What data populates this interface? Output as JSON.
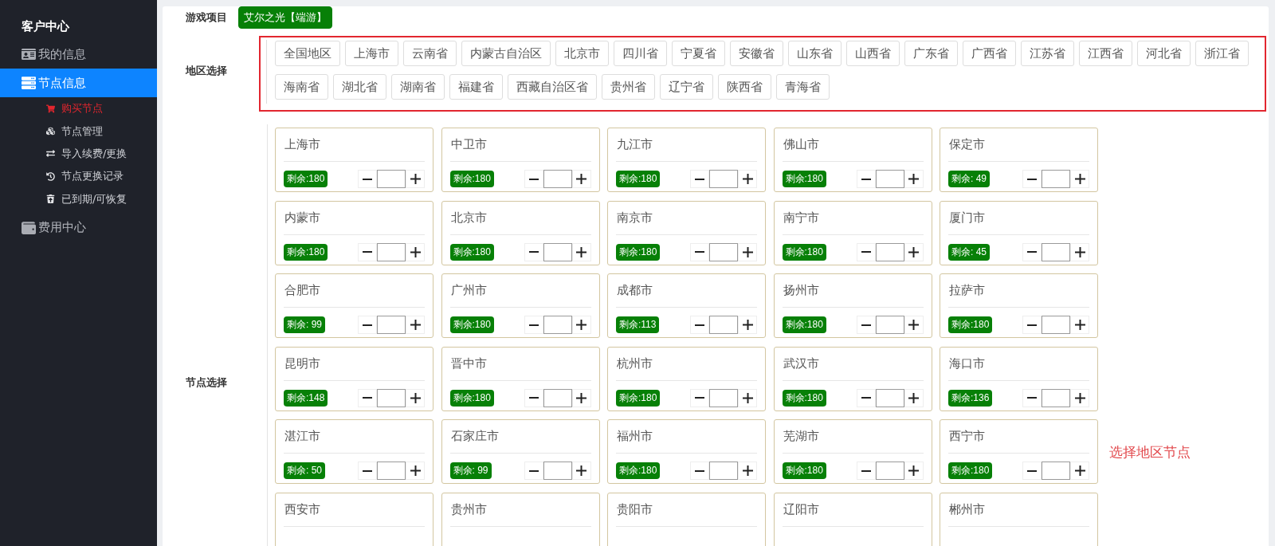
{
  "sidebar": {
    "title": "客户中心",
    "items": [
      {
        "label": "我的信息",
        "selected": false
      },
      {
        "label": "节点信息",
        "selected": true,
        "children": [
          {
            "label": "购买节点",
            "selected": true
          },
          {
            "label": "节点管理",
            "selected": false
          },
          {
            "label": "导入续费/更换",
            "selected": false
          },
          {
            "label": "节点更换记录",
            "selected": false
          },
          {
            "label": "已到期/可恢复",
            "selected": false
          }
        ]
      },
      {
        "label": "费用中心",
        "selected": false
      }
    ]
  },
  "game": {
    "label": "游戏项目",
    "options": [
      {
        "label": "艾尔之光【端游】",
        "selected": true
      }
    ]
  },
  "region": {
    "label": "地区选择",
    "options": [
      {
        "label": "全国地区",
        "selected": false
      },
      {
        "label": "上海市",
        "selected": false
      },
      {
        "label": "云南省",
        "selected": false
      },
      {
        "label": "内蒙古自治区",
        "selected": false
      },
      {
        "label": "北京市",
        "selected": false
      },
      {
        "label": "四川省",
        "selected": false
      },
      {
        "label": "宁夏省",
        "selected": false
      },
      {
        "label": "安徽省",
        "selected": false
      },
      {
        "label": "山东省",
        "selected": false
      },
      {
        "label": "山西省",
        "selected": false
      },
      {
        "label": "广东省",
        "selected": false
      },
      {
        "label": "广西省",
        "selected": false
      },
      {
        "label": "江苏省",
        "selected": false
      },
      {
        "label": "江西省",
        "selected": false
      },
      {
        "label": "河北省",
        "selected": false
      },
      {
        "label": "浙江省",
        "selected": false
      },
      {
        "label": "海南省",
        "selected": false
      },
      {
        "label": "湖北省",
        "selected": false
      },
      {
        "label": "湖南省",
        "selected": false
      },
      {
        "label": "福建省",
        "selected": false
      },
      {
        "label": "西藏自治区省",
        "selected": false
      },
      {
        "label": "贵州省",
        "selected": false
      },
      {
        "label": "辽宁省",
        "selected": false
      },
      {
        "label": "陕西省",
        "selected": false
      },
      {
        "label": "青海省",
        "selected": false
      }
    ]
  },
  "nodes": {
    "label": "节点选择",
    "annotation": "选择地区节点",
    "cards": [
      {
        "name": "上海市",
        "remaining": "剩余:180"
      },
      {
        "name": "中卫市",
        "remaining": "剩余:180"
      },
      {
        "name": "九江市",
        "remaining": "剩余:180"
      },
      {
        "name": "佛山市",
        "remaining": "剩余:180"
      },
      {
        "name": "保定市",
        "remaining": "剩余: 49"
      },
      {
        "name": "内蒙市",
        "remaining": "剩余:180"
      },
      {
        "name": "北京市",
        "remaining": "剩余:180"
      },
      {
        "name": "南京市",
        "remaining": "剩余:180"
      },
      {
        "name": "南宁市",
        "remaining": "剩余:180"
      },
      {
        "name": "厦门市",
        "remaining": "剩余: 45"
      },
      {
        "name": "合肥市",
        "remaining": "剩余: 99"
      },
      {
        "name": "广州市",
        "remaining": "剩余:180"
      },
      {
        "name": "成都市",
        "remaining": "剩余:113"
      },
      {
        "name": "扬州市",
        "remaining": "剩余:180"
      },
      {
        "name": "拉萨市",
        "remaining": "剩余:180"
      },
      {
        "name": "昆明市",
        "remaining": "剩余:148"
      },
      {
        "name": "晋中市",
        "remaining": "剩余:180"
      },
      {
        "name": "杭州市",
        "remaining": "剩余:180"
      },
      {
        "name": "武汉市",
        "remaining": "剩余:180"
      },
      {
        "name": "海口市",
        "remaining": "剩余:136"
      },
      {
        "name": "湛江市",
        "remaining": "剩余: 50"
      },
      {
        "name": "石家庄市",
        "remaining": "剩余: 99"
      },
      {
        "name": "福州市",
        "remaining": "剩余:180"
      },
      {
        "name": "芜湖市",
        "remaining": "剩余:180"
      },
      {
        "name": "西宁市",
        "remaining": "剩余:180"
      },
      {
        "name": "西安市"
      },
      {
        "name": "贵州市"
      },
      {
        "name": "贵阳市"
      },
      {
        "name": "辽阳市"
      },
      {
        "name": "郴州市"
      }
    ]
  }
}
